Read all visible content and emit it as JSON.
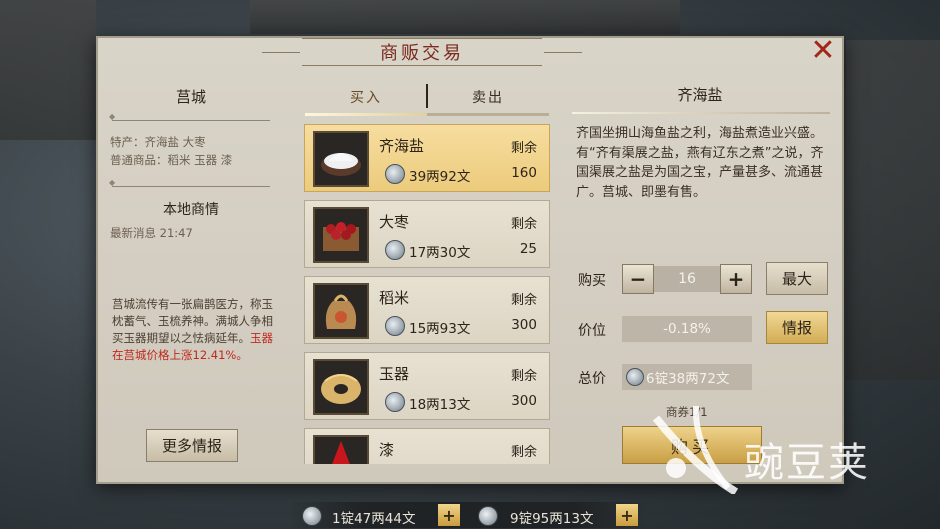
{
  "window": {
    "title": "商贩交易"
  },
  "city": {
    "name": "莒城",
    "specialty_line": "特产：齐海盐 大枣",
    "common_line": "普通商品：稻米 玉器 漆"
  },
  "market": {
    "title": "本地商情",
    "latest": "最新消息 21:47",
    "news_text": "莒城流传有一张扁鹊医方，称玉枕蓄气、玉梳养神。满城人争相买玉器期望以之怯病延年。",
    "news_highlight": "玉器在莒城价格上涨12.41%。",
    "more_label": "更多情报"
  },
  "tabs": {
    "buy": "买入",
    "sell": "卖出"
  },
  "remain_label": "剩余",
  "goods": [
    {
      "name": "齐海盐",
      "price": "39两92文",
      "remain": "160"
    },
    {
      "name": "大枣",
      "price": "17两30文",
      "remain": "25"
    },
    {
      "name": "稻米",
      "price": "15两93文",
      "remain": "300"
    },
    {
      "name": "玉器",
      "price": "18两13文",
      "remain": "300"
    },
    {
      "name": "漆",
      "remain_label": "剩余"
    }
  ],
  "detail": {
    "name": "齐海盐",
    "description": "齐国坐拥山海鱼盐之利，海盐煮造业兴盛。有“齐有渠展之盐，燕有辽东之煮”之说，齐国渠展之盐是为国之宝，产量甚多、流通甚广。莒城、即墨有售。",
    "buy_label": "购买",
    "quantity": "16",
    "max_label": "最大",
    "price_label": "价位",
    "price_change": "-0.18%",
    "intel_label": "情报",
    "total_label": "总价",
    "total_value": "6锭38两72文",
    "ticket": "商券1/1",
    "buy_button": "购买"
  },
  "wallet": {
    "silver": "1锭47两44文",
    "second": "9锭95两13文"
  },
  "watermark": "豌豆荚",
  "colors": {
    "accent_red": "#c0281e",
    "gold": "#d3ad56",
    "panel": "#d9d4c8"
  }
}
